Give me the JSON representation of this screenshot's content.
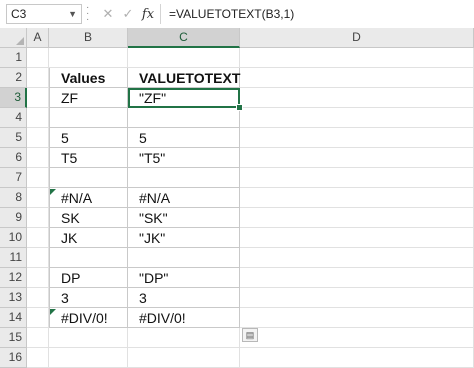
{
  "formula_bar": {
    "name_box": "C3",
    "cancel_icon": "✕",
    "enter_icon": "✓",
    "fx_label": "fx",
    "formula": "=VALUETOTEXT(B3,1)"
  },
  "columns": [
    "A",
    "B",
    "C",
    "D"
  ],
  "selected_column": "C",
  "rows": [
    "1",
    "2",
    "3",
    "4",
    "5",
    "6",
    "7",
    "8",
    "9",
    "10",
    "11",
    "12",
    "13",
    "14",
    "15",
    "16"
  ],
  "selected_row": "3",
  "table": {
    "header": {
      "values": "Values",
      "valuetotext": "VALUETOTEXT"
    },
    "rows": [
      {
        "row": "3",
        "b": "ZF",
        "c": "\"ZF\""
      },
      {
        "row": "4",
        "b": "",
        "c": ""
      },
      {
        "row": "5",
        "b": "5",
        "c": "5"
      },
      {
        "row": "6",
        "b": "T5",
        "c": "\"T5\""
      },
      {
        "row": "7",
        "b": "",
        "c": ""
      },
      {
        "row": "8",
        "b": "#N/A",
        "c": "#N/A"
      },
      {
        "row": "9",
        "b": "SK",
        "c": "\"SK\""
      },
      {
        "row": "10",
        "b": "JK",
        "c": "\"JK\""
      },
      {
        "row": "11",
        "b": "",
        "c": ""
      },
      {
        "row": "12",
        "b": "DP",
        "c": "\"DP\""
      },
      {
        "row": "13",
        "b": "3",
        "c": "3"
      },
      {
        "row": "14",
        "b": "#DIV/0!",
        "c": "#DIV/0!"
      }
    ]
  },
  "colors": {
    "accent": "#217346",
    "header_bg": "#eaeaea",
    "selected_header_bg": "#d2d2d2"
  },
  "icons": {
    "error_indicator": "green-triangle-icon",
    "paste_options": "paste-options-icon"
  }
}
